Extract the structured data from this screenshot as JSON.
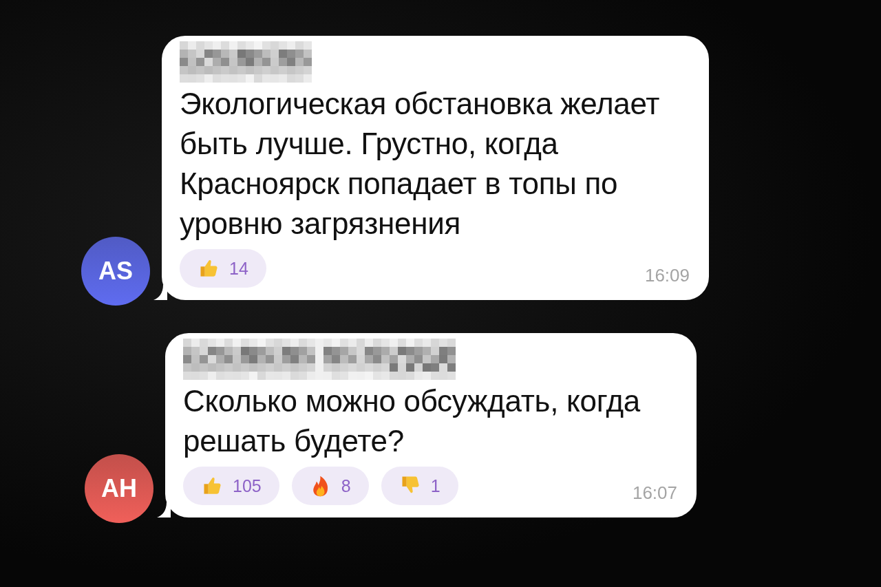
{
  "messages": [
    {
      "avatar": {
        "initials": "AS",
        "color": "#5f6cf0"
      },
      "sender": {
        "redacted": true,
        "kind": "short"
      },
      "text": "Экологическая обстановка желает быть лучше. Грустно, когда Красноярск попадает в топы по уровню загрязнения",
      "reactions": [
        {
          "kind": "thumbs_up",
          "count": "14"
        }
      ],
      "time": "16:09"
    },
    {
      "avatar": {
        "initials": "AH",
        "color": "#f0605a"
      },
      "sender": {
        "redacted": true,
        "kind": "long"
      },
      "text": "Сколько можно обсуждать, когда решать будете?",
      "reactions": [
        {
          "kind": "thumbs_up",
          "count": "105"
        },
        {
          "kind": "fire",
          "count": "8"
        },
        {
          "kind": "thumbs_down",
          "count": "1"
        }
      ],
      "time": "16:07"
    }
  ]
}
